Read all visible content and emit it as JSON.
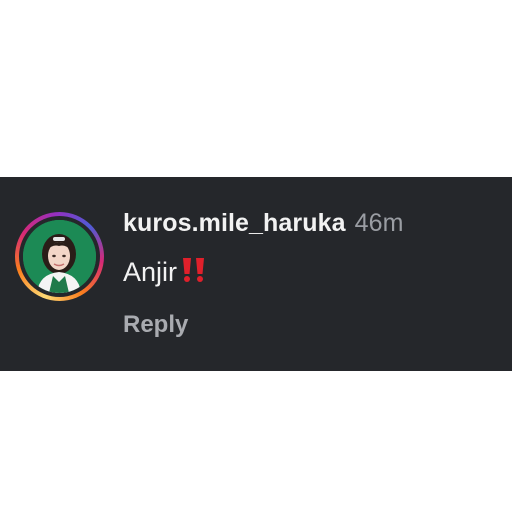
{
  "comment": {
    "username": "kuros.mile_haruka",
    "timestamp": "46m",
    "text": "Anjir",
    "emoji": "double-exclamation-mark-emoji",
    "reply_label": "Reply"
  },
  "colors": {
    "card_background": "#25272b",
    "text_primary": "#f2f2f2",
    "text_secondary": "#9a9da3",
    "emoji_red": "#e0202b",
    "avatar_background": "#1c8a55"
  },
  "icons": {
    "avatar": "profile-photo",
    "story_ring": "story-ring-gradient"
  }
}
